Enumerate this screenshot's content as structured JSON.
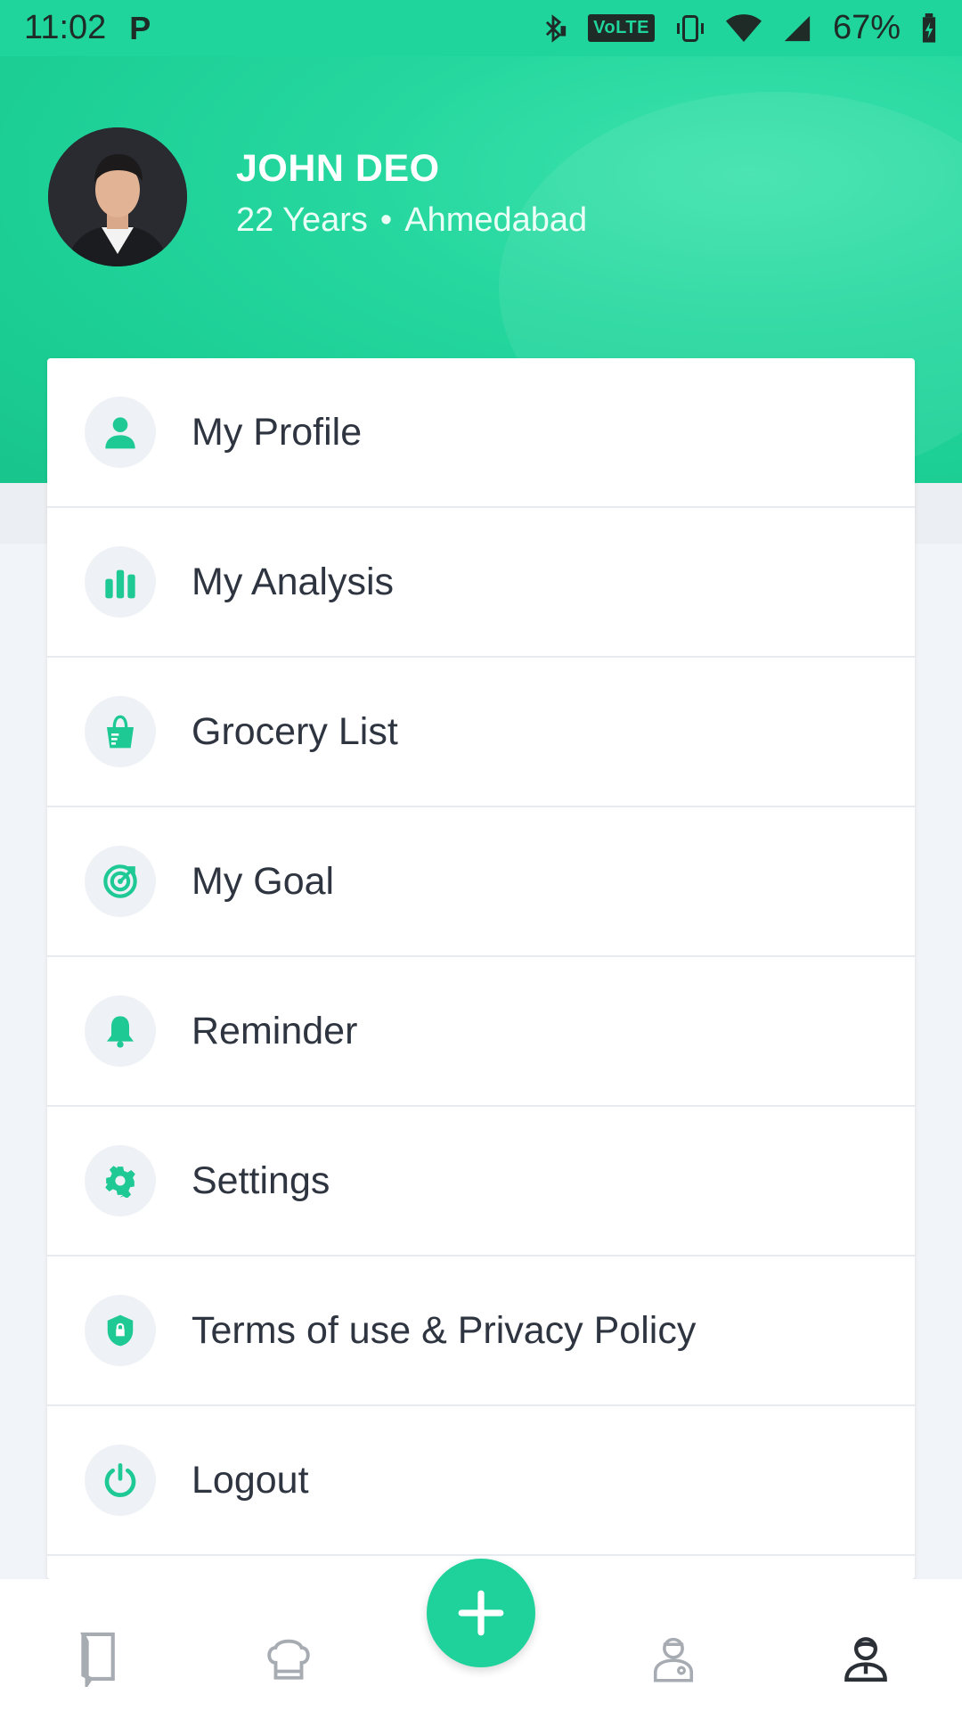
{
  "status_bar": {
    "time": "11:02",
    "carrier_icon": "P",
    "volte": "VoLTE",
    "battery_percent": "67%",
    "icons": [
      "bluetooth-icon",
      "vibrate-icon",
      "wifi-icon",
      "signal-icon",
      "battery-charging-icon"
    ]
  },
  "profile": {
    "name": "JOHN DEO",
    "age": "22 Years",
    "separator": "•",
    "city": "Ahmedabad"
  },
  "menu": {
    "items": [
      {
        "label": "My Profile",
        "icon": "person-icon"
      },
      {
        "label": "My Analysis",
        "icon": "bar-chart-icon"
      },
      {
        "label": "Grocery List",
        "icon": "grocery-bag-icon"
      },
      {
        "label": "My Goal",
        "icon": "target-icon"
      },
      {
        "label": "Reminder",
        "icon": "bell-icon"
      },
      {
        "label": "Settings",
        "icon": "gear-icon"
      },
      {
        "label": "Terms of use & Privacy Policy",
        "icon": "shield-lock-icon"
      },
      {
        "label": "Logout",
        "icon": "power-icon"
      }
    ]
  },
  "bottom_nav": {
    "items": [
      "book-icon",
      "chef-hat-icon",
      "add-icon",
      "doctor-icon",
      "user-icon"
    ],
    "active": "user-icon"
  },
  "colors": {
    "accent": "#1fd59b",
    "icon_green": "#1ec994",
    "icon_bg": "#eef2f6",
    "nav_inactive": "#a7abb2",
    "nav_active": "#2b2f36"
  }
}
